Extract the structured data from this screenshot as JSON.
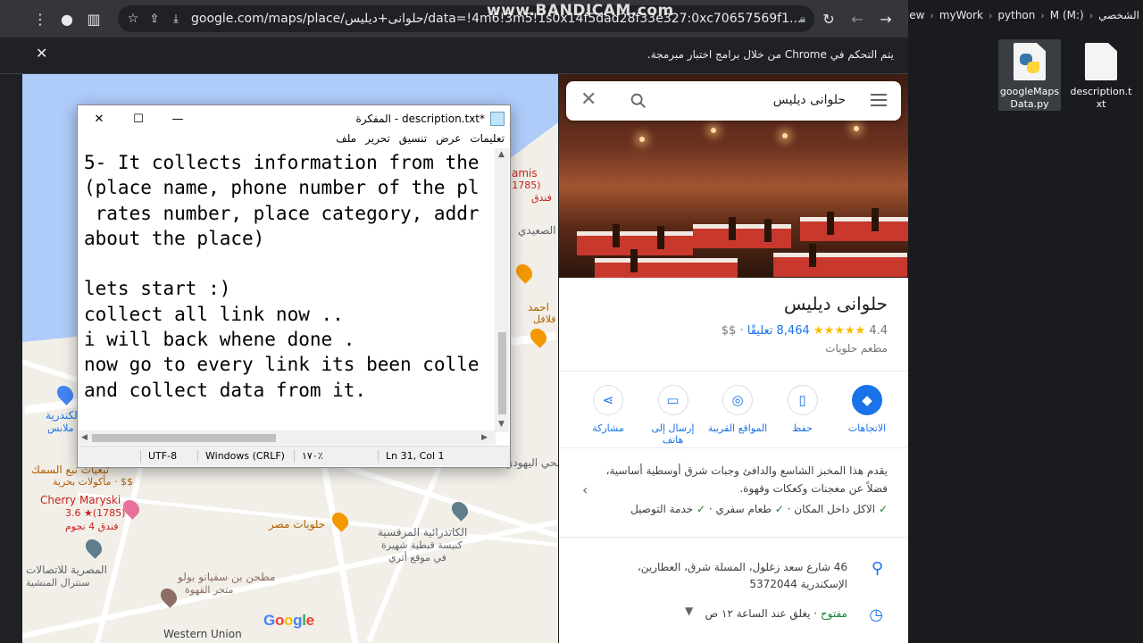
{
  "browser": {
    "url": "google.com/maps/place/حلوانى+ديليس/data=!4m6!3m5!1s0x14f5dad28f33e327:0xc70657569f1...",
    "watermark": "www.BANDICAM.com",
    "automation_notice": "يتم التحكم في Chrome من خلال برامج اختبار مبرمجة."
  },
  "explorer": {
    "crumbs": [
      "الشخصي",
      "python",
      "myWork",
      "New",
      "M (M:)"
    ],
    "files": [
      {
        "name": "googleMapsData.py",
        "icon": "python-file-icon"
      },
      {
        "name": "description.txt",
        "icon": "text-file-icon"
      }
    ]
  },
  "map": {
    "labels": [
      "Cherry Maryski",
      "3.6 ★(1785)",
      "فندق 4 نجوم",
      "حلويات مصر",
      "الكاتدرائية المرقسية",
      "كنيسة قبطية شهيرة",
      "في موقع أثري",
      "المصرية للاتصالات",
      "سنترال المنشية",
      "مطحن بن سفيانو بولو",
      "متجر القهوة",
      "Western Union",
      "تبعيات نبع السمك",
      "مأكولات بحرية · $$",
      "الصعيدي",
      "احمد",
      "فلافل",
      "الكندرية",
      "ملابس",
      "amis",
      "(1785)",
      "فندق",
      "الحي اليهودي"
    ],
    "google_logo": "Google"
  },
  "panel": {
    "search_query": "حلوانى ديليس",
    "place_name": "حلوانى ديليس",
    "rating": "4.4",
    "stars": "★★★★★",
    "reviews": "8,464 تعليقًا",
    "price": "$$",
    "category": "مطعم حلويات",
    "actions": [
      {
        "label": "الاتجاهات",
        "icon": "directions-icon",
        "primary": true
      },
      {
        "label": "حفظ",
        "icon": "bookmark-icon",
        "primary": false
      },
      {
        "label": "المواقع القريبة",
        "icon": "nearby-icon",
        "primary": false
      },
      {
        "label": "إرسال إلى هاتف",
        "icon": "phone-icon",
        "primary": false
      },
      {
        "label": "مشاركة",
        "icon": "share-icon",
        "primary": false
      }
    ],
    "about": "يقدم هذا المخبز الشاسع والدافئ وجبات شرق أوسطية أساسية، فضلاً عن معجنات وكعكات وقهوة.",
    "amenities": [
      "الاكل داخل المكان",
      "طعام سفري",
      "خدمة التوصيل"
    ],
    "address": "46 شارع سعد زغلول، المسلة شرق، العطارين، الإسكندرية 5372044",
    "hours_status": "مفتوح",
    "hours_detail": "يغلق عند الساعة ١٢ ص"
  },
  "notepad": {
    "title": "*description.txt - المفكرة",
    "menu": [
      "ملف",
      "تحرير",
      "تنسيق",
      "عرض",
      "تعليمات"
    ],
    "lines": [
      "5- It collects information from the",
      "(place name, phone number of the pl",
      " rates number, place category, addr",
      "about the place)",
      "",
      "lets start :)",
      "collect all link now ..",
      "i will back whene done .",
      "now go to every link its been colle",
      "and collect data from it."
    ],
    "status": {
      "position": "Ln 31, Col 1",
      "zoom": "١٧٠٪",
      "line_ending": "Windows (CRLF)",
      "encoding": "UTF-8"
    }
  }
}
